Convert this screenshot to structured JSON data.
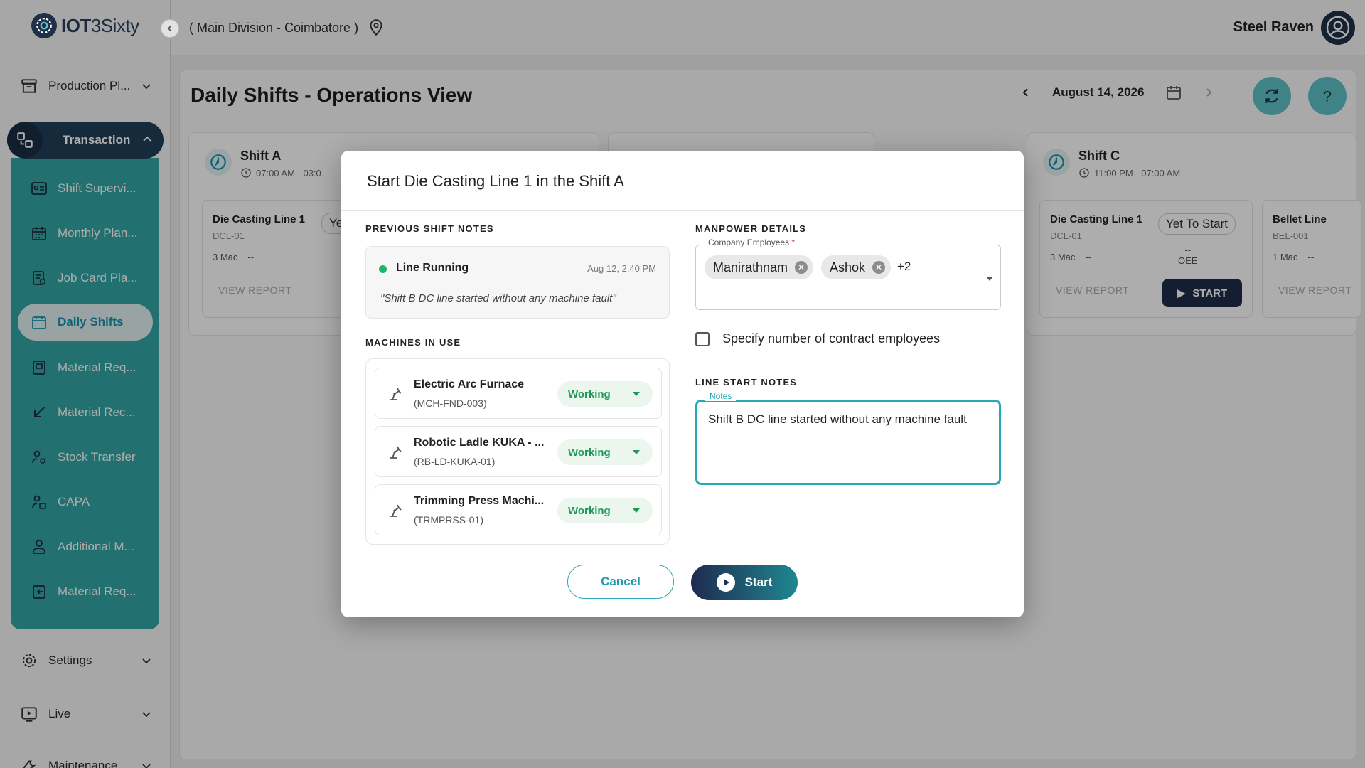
{
  "header": {
    "brand_bold": "IOT",
    "brand_rest": "3Sixty",
    "division": "( Main Division - Coimbatore )",
    "username": "Steel Raven"
  },
  "sidebar": {
    "production": "Production Pl...",
    "transaction": "Transaction",
    "sub_items": [
      {
        "label": "Shift Supervi...",
        "icon": "id-card-icon"
      },
      {
        "label": "Monthly Plan...",
        "icon": "calendar-grid-icon"
      },
      {
        "label": "Job Card Pla...",
        "icon": "job-card-icon"
      },
      {
        "label": "Daily Shifts",
        "icon": "calendar-icon"
      },
      {
        "label": "Material Req...",
        "icon": "material-request-icon"
      },
      {
        "label": "Material Rec...",
        "icon": "arrow-down-left-icon"
      },
      {
        "label": "Stock Transfer",
        "icon": "stock-transfer-icon"
      },
      {
        "label": "CAPA",
        "icon": "capa-icon"
      },
      {
        "label": "Additional M...",
        "icon": "person-icon"
      },
      {
        "label": "Material Req...",
        "icon": "material-return-icon"
      }
    ],
    "settings": "Settings",
    "live": "Live",
    "maintenance": "Maintenance"
  },
  "main": {
    "title": "Daily Shifts - Operations View",
    "date": "August 14, 2026",
    "shift_a": {
      "name": "Shift A",
      "time": "07:00 AM - 03:0",
      "line": {
        "name": "Die Casting Line 1",
        "code": "DCL-01",
        "machines": "3 Mac",
        "people": "--",
        "status": "Ye",
        "view_report": "VIEW REPORT"
      }
    },
    "shift_c": {
      "name": "Shift C",
      "time": "11:00 PM - 07:00 AM",
      "line1": {
        "name": "Die Casting Line 1",
        "code": "DCL-01",
        "machines": "3 Mac",
        "people": "--",
        "status": "Yet To Start",
        "oee_value": "--",
        "oee_label": "OEE",
        "view_report": "VIEW REPORT",
        "start": "START"
      },
      "line2": {
        "name": "Bellet Line",
        "code": "BEL-001",
        "machines": "1 Mac",
        "people": "--",
        "view_report": "VIEW REPORT"
      }
    }
  },
  "modal": {
    "title": "Start Die Casting Line 1 in the Shift A",
    "prev_notes_label": "PREVIOUS SHIFT NOTES",
    "prev_status": "Line Running",
    "prev_date": "Aug 12, 2:40 PM",
    "prev_text": "\"Shift B DC line started without any machine fault\"",
    "machines_label": "MACHINES IN USE",
    "machines": [
      {
        "name": "Electric Arc Furnace",
        "code": "(MCH-FND-003)",
        "status": "Working"
      },
      {
        "name": "Robotic Ladle KUKA - ...",
        "code": "(RB-LD-KUKA-01)",
        "status": "Working"
      },
      {
        "name": "Trimming Press Machi...",
        "code": "(TRMPRSS-01)",
        "status": "Working"
      }
    ],
    "manpower_label": "MANPOWER DETAILS",
    "employees_label": "Company Employees",
    "required_mark": "*",
    "chips": [
      "Manirathnam",
      "Ashok"
    ],
    "more_count": "+2",
    "contract_label": "Specify number of contract employees",
    "line_notes_label": "LINE START NOTES",
    "notes_label": "Notes",
    "notes_value": "Shift B DC line started without any machine fault",
    "cancel": "Cancel",
    "start": "Start"
  },
  "colors": {
    "teal": "#33a6a6",
    "navy": "#1f2b4a",
    "working_green": "#1c9a55",
    "focus": "#26a9b6"
  }
}
